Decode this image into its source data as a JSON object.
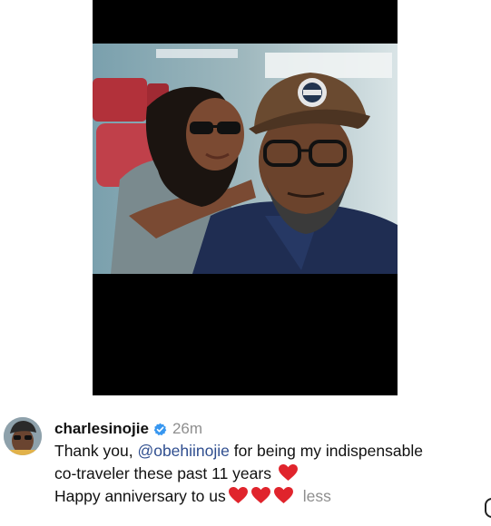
{
  "post": {
    "media_alt": "Selfie of two people on a train"
  },
  "comment": {
    "username": "charlesinojie",
    "verified_icon": "verified-badge-icon",
    "timestamp": "26m",
    "line1_prefix": "Thank you, ",
    "mention": "@obehiinojie",
    "line1_suffix": " for being my indispensable",
    "line2": "co-traveler these past 11 years ",
    "line3": "Happy anniversary to us",
    "toggle": "less",
    "heart_icon": "red-heart-icon"
  },
  "colors": {
    "mention": "#2f4e8f",
    "verified": "#3897f0",
    "heart": "#e0242c",
    "muted": "#8e8e8e"
  }
}
